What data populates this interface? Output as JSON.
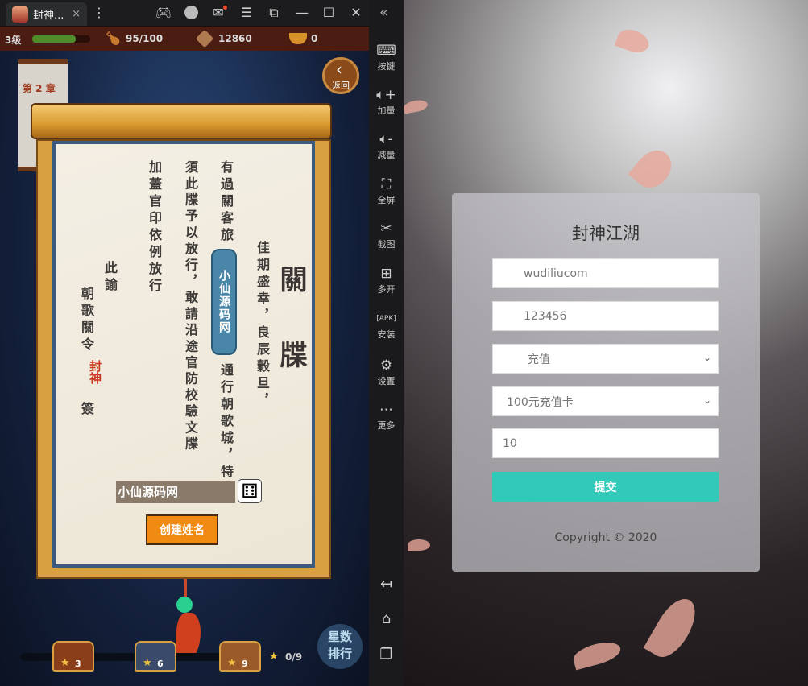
{
  "window": {
    "tab_title": "封神...",
    "tab_close": "×"
  },
  "titlebar_icons": [
    "more-vertical-icon",
    "gamepad-icon",
    "user-avatar-icon",
    "mail-icon",
    "menu-icon",
    "shrink-icon",
    "minimize-icon",
    "maximize-icon",
    "close-icon",
    "collapse-icon"
  ],
  "game": {
    "level": "3级",
    "exp_fraction": 0.75,
    "stamina": "95/100",
    "coins": "12860",
    "gold": "0",
    "chapter": "第 2 章",
    "back_label": "返回",
    "scroll": {
      "heading": "關牒",
      "col1": "佳期盛幸，良辰穀旦，",
      "col2a": "有過關客旅",
      "col2_badge": "小仙源码网",
      "col2b": "通行朝歌城，特",
      "col3": "須此牒予以放行，敢請沿途官防校驗文牒",
      "col4": "加蓋官印依例放行",
      "col5": "此諭",
      "col6": "朝歌關令",
      "seal": "封神",
      "sign": "簽",
      "name_input": "小仙源码网",
      "create_button": "创建姓名"
    },
    "chests": [
      {
        "stars": "3"
      },
      {
        "stars": "6"
      },
      {
        "stars": "9"
      }
    ],
    "star_progress": "0/9",
    "rank_label": "星数排行"
  },
  "sidebar": {
    "items": [
      {
        "label": "按键",
        "icon": "keyboard-icon"
      },
      {
        "label": "加量",
        "icon": "volume-up-icon"
      },
      {
        "label": "减量",
        "icon": "volume-down-icon"
      },
      {
        "label": "全屏",
        "icon": "fullscreen-icon"
      },
      {
        "label": "截图",
        "icon": "scissors-icon"
      },
      {
        "label": "多开",
        "icon": "multi-open-icon"
      },
      {
        "label": "安装",
        "icon": "apk-icon"
      },
      {
        "label": "设置",
        "icon": "settings-icon"
      },
      {
        "label": "更多",
        "icon": "more-icon"
      }
    ],
    "nav": [
      "back-icon",
      "home-icon",
      "recents-icon"
    ]
  },
  "form": {
    "title": "封神江湖",
    "username": "wudiliucom",
    "password": "123456",
    "action_select": "充值",
    "card_select": "100元充值卡",
    "quantity": "10",
    "submit": "提交",
    "copyright": "Copyright © 2020",
    "accent": "#32c9b8"
  }
}
